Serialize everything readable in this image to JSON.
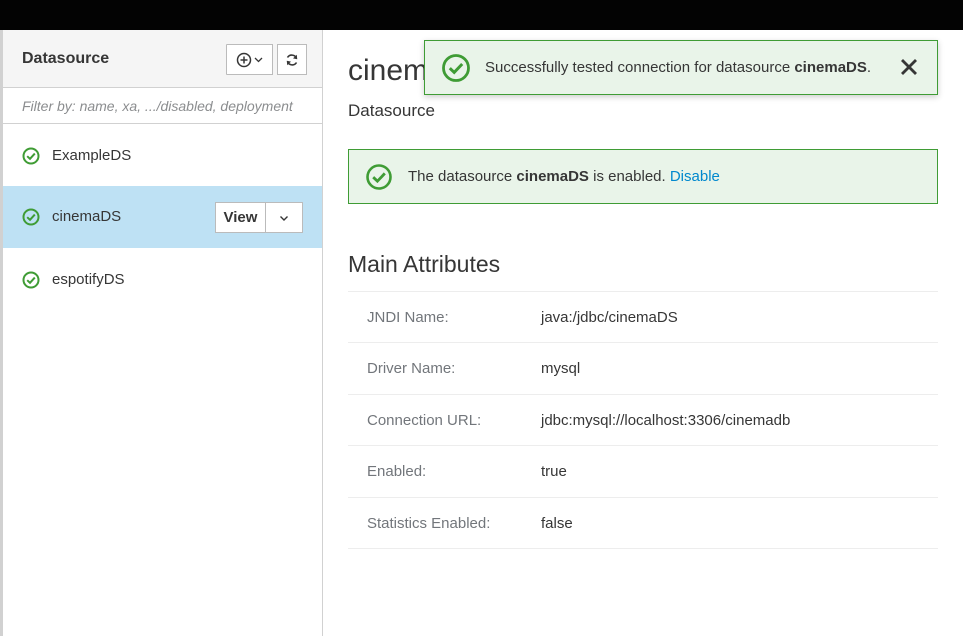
{
  "colors": {
    "success": "#3f9c35",
    "success_bg": "#e9f4e9",
    "selected_bg": "#bee1f4",
    "link": "#0088ce",
    "topbar": "#030303"
  },
  "sidebar": {
    "title": "Datasource",
    "add_icon": "plus-circle-icon",
    "refresh_icon": "refresh-icon",
    "filter_placeholder": "Filter by: name, xa, .../disabled, deployment",
    "items": [
      {
        "label": "ExampleDS",
        "status_icon": "check-circle-icon",
        "selected": false
      },
      {
        "label": "cinemaDS",
        "status_icon": "check-circle-icon",
        "selected": true,
        "view_label": "View"
      },
      {
        "label": "espotifyDS",
        "status_icon": "check-circle-icon",
        "selected": false
      }
    ]
  },
  "main": {
    "title": "cinemaDS",
    "subtitle": "Datasource",
    "status_alert": {
      "prefix": "The datasource ",
      "name": "cinemaDS",
      "suffix": " is enabled. ",
      "action": "Disable"
    },
    "section_title": "Main Attributes",
    "attributes": [
      {
        "key": "JNDI Name:",
        "value": "java:/jdbc/cinemaDS"
      },
      {
        "key": "Driver Name:",
        "value": "mysql"
      },
      {
        "key": "Connection URL:",
        "value": "jdbc:mysql://localhost:3306/cinemadb"
      },
      {
        "key": "Enabled:",
        "value": "true"
      },
      {
        "key": "Statistics Enabled:",
        "value": "false"
      }
    ]
  },
  "toast": {
    "prefix": "Successfully tested connection for datasource ",
    "name": "cinemaDS",
    "suffix": ".",
    "icon": "check-circle-icon",
    "close_icon": "close-icon"
  }
}
